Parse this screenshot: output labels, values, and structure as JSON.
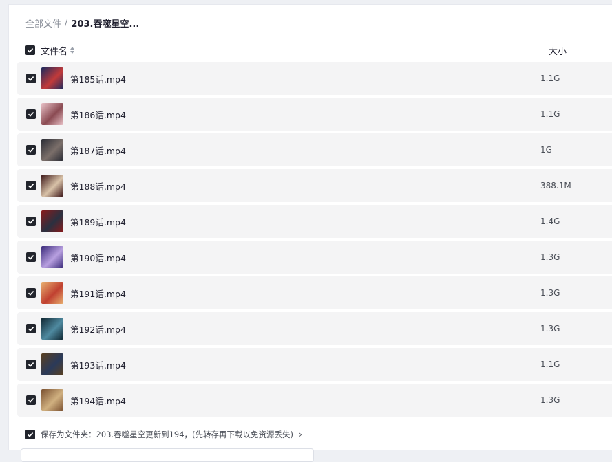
{
  "breadcrumb": {
    "root": "全部文件",
    "separator": "/",
    "current": "203.吞噬星空..."
  },
  "table": {
    "header_name": "文件名",
    "header_size": "大小",
    "rows": [
      {
        "name": "第185话.mp4",
        "size": "1.1G",
        "colors": [
          "#1b2a5e",
          "#c23a3a"
        ]
      },
      {
        "name": "第186话.mp4",
        "size": "1.1G",
        "colors": [
          "#e9c2c8",
          "#8a4a52"
        ]
      },
      {
        "name": "第187话.mp4",
        "size": "1G",
        "colors": [
          "#2a2c35",
          "#7b6f6a"
        ]
      },
      {
        "name": "第188话.mp4",
        "size": "388.1M",
        "colors": [
          "#3a1416",
          "#d8c2a8"
        ]
      },
      {
        "name": "第189话.mp4",
        "size": "1.4G",
        "colors": [
          "#8a1a1a",
          "#2a3040"
        ]
      },
      {
        "name": "第190话.mp4",
        "size": "1.3G",
        "colors": [
          "#3a2a7a",
          "#b8a0e0"
        ]
      },
      {
        "name": "第191话.mp4",
        "size": "1.3G",
        "colors": [
          "#e8b070",
          "#c04030"
        ]
      },
      {
        "name": "第192话.mp4",
        "size": "1.3G",
        "colors": [
          "#0f2530",
          "#4f8aa0"
        ]
      },
      {
        "name": "第193话.mp4",
        "size": "1.1G",
        "colors": [
          "#5a4020",
          "#2a3a5a"
        ]
      },
      {
        "name": "第194话.mp4",
        "size": "1.3G",
        "colors": [
          "#7a5030",
          "#d0b080"
        ]
      }
    ]
  },
  "save": {
    "label": "保存为文件夹：203.吞噬星空更新到194，(先转存再下载以免资源丢失)",
    "chevron": "›"
  },
  "icons": {
    "checkbox": "checkbox-checked-icon",
    "sort": "sort-icon",
    "chevron": "chevron-right-icon"
  }
}
